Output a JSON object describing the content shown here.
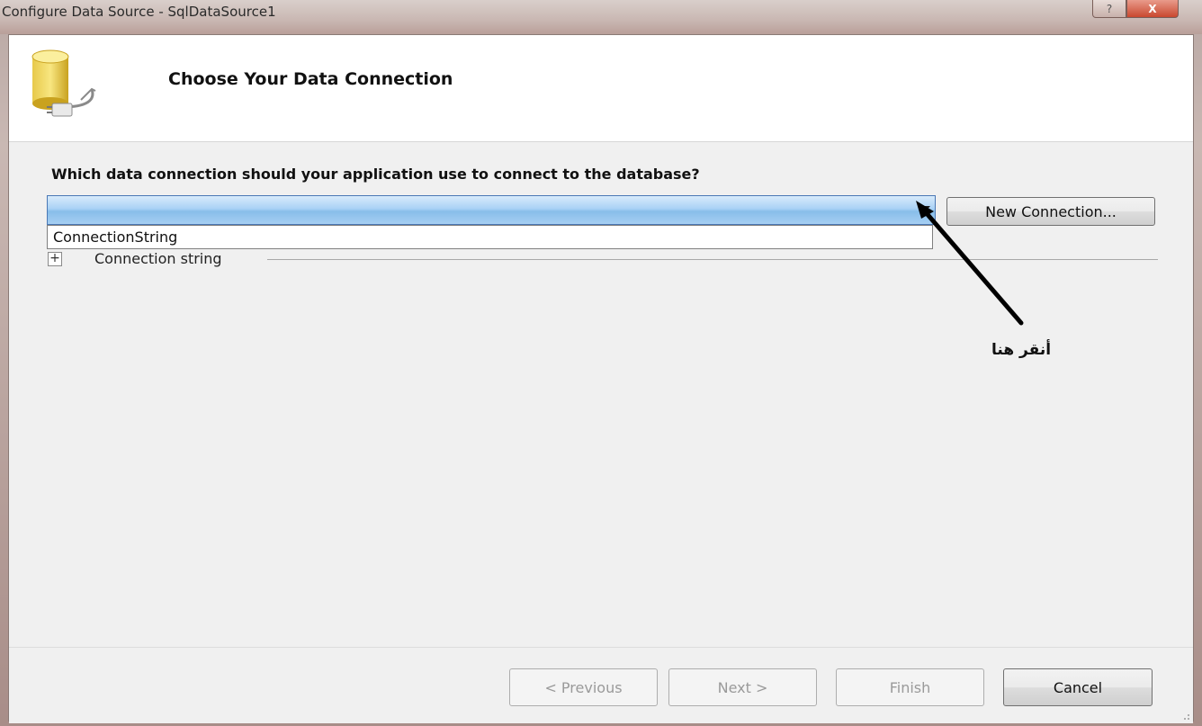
{
  "window": {
    "title": "Configure Data Source - SqlDataSource1",
    "help_glyph": "?",
    "close_glyph": "X"
  },
  "header": {
    "title": "Choose Your Data Connection",
    "icon": "database-connection-icon"
  },
  "main": {
    "question": "Which data connection should your application use to connect to the database?",
    "combo_value": "",
    "dropdown_options": [
      "ConnectionString"
    ],
    "new_connection_label": "New Connection...",
    "expander_glyph": "+",
    "connection_string_label": "Connection string"
  },
  "annotation": {
    "note": "أنقر هنا",
    "arrow_color": "#000000"
  },
  "footer": {
    "previous_label": "< Previous",
    "next_label": "Next >",
    "finish_label": "Finish",
    "cancel_label": "Cancel"
  },
  "colors": {
    "combo_selected": "#a9d1f5",
    "dialog_bg": "#f0f0f0"
  }
}
